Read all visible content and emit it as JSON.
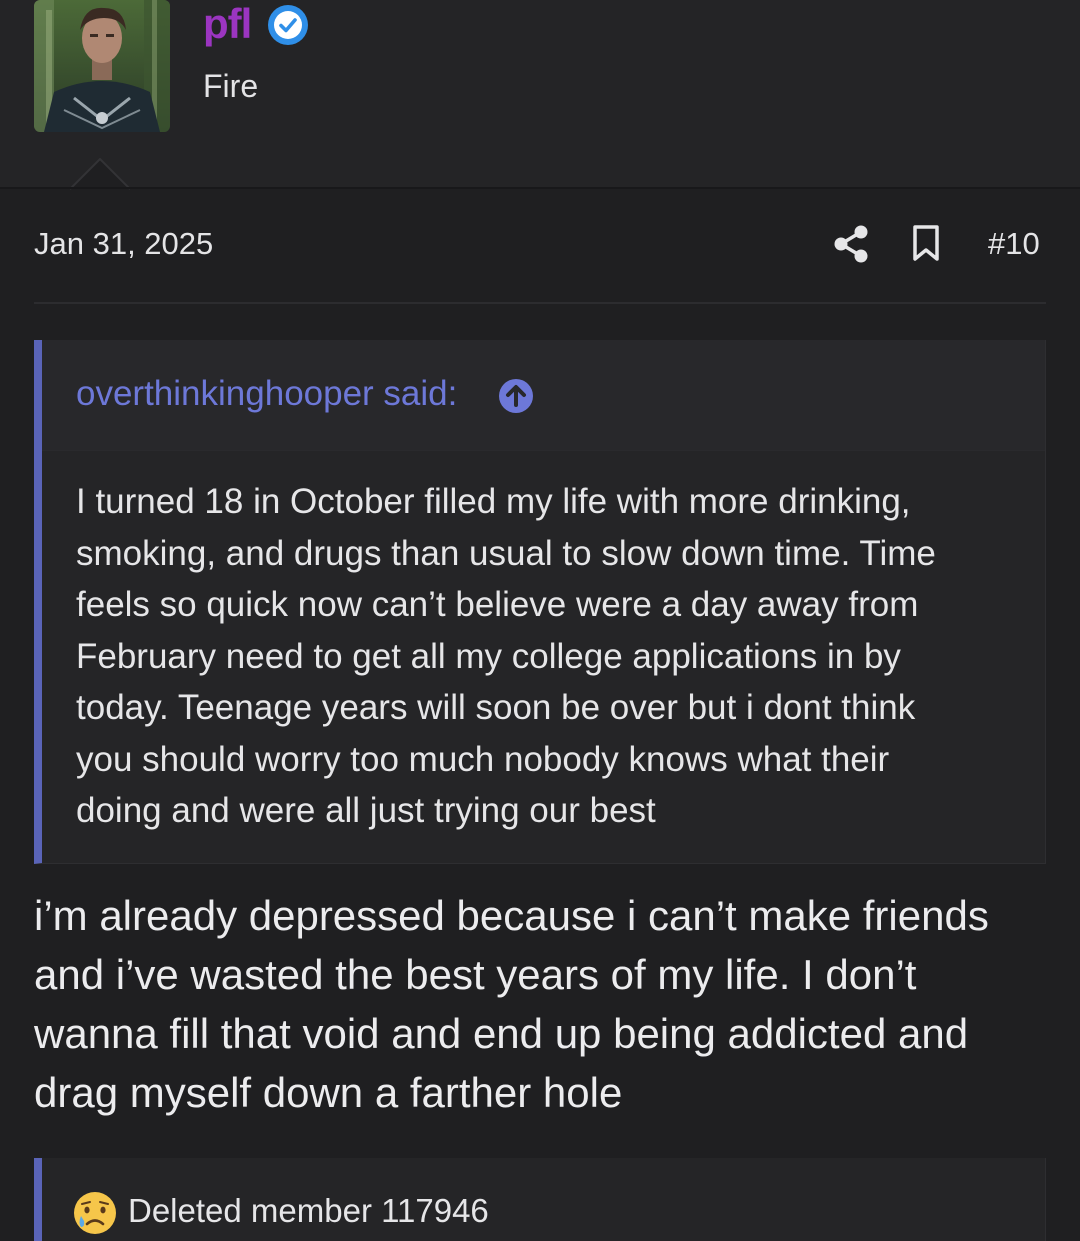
{
  "author": {
    "username": "pfl",
    "title": "Fire",
    "avatar_icon": "user-avatar",
    "verified_icon": "verified-badge-icon"
  },
  "post": {
    "date": "Jan 31, 2025",
    "number": "#10",
    "share_icon": "share-icon",
    "bookmark_icon": "bookmark-icon"
  },
  "quote": {
    "author_line": "overthinkinghooper said:",
    "jump_icon": "arrow-up-circle-icon",
    "lines": [
      "I turned 18 in October filled my life with more drinking,",
      "smoking, and drugs than usual to slow down time. Time",
      "feels so quick now can’t believe were a day away from",
      "February need to get all my college applications in by",
      "today. Teenage years will soon be over but i dont think",
      "you should worry too much nobody knows what their",
      "doing and were all just trying our best"
    ]
  },
  "message": {
    "lines": [
      "i’m already depressed because i can’t make friends",
      "and i’ve wasted the best years of my life. I don’t",
      "wanna fill that void and end up being addicted and",
      "drag myself down a farther hole"
    ]
  },
  "reply_preview": {
    "emoji_icon": "crying-face-emoji",
    "author": "Deleted member 117946"
  },
  "colors": {
    "background": "#1f1f21",
    "username": "#9b35c0",
    "quote_accent": "#5a64b8",
    "quote_author": "#6d78d8",
    "verified": "#2f8fe8"
  }
}
